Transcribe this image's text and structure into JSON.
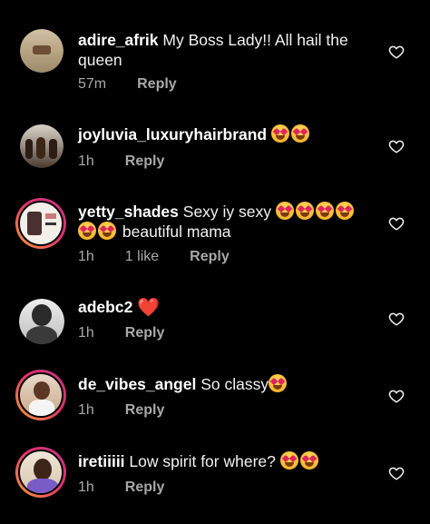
{
  "comments": [
    {
      "username": "adire_afrik",
      "text": "My Boss Lady!! All hail the queen",
      "time": "57m",
      "likes": "",
      "reply": "Reply",
      "emoji_count": 0
    },
    {
      "username": "joyluvia_luxuryhairbrand",
      "text": "",
      "time": "1h",
      "likes": "",
      "reply": "Reply",
      "emoji_count": 2
    },
    {
      "username": "yetty_shades",
      "text": "Sexy iy sexy",
      "text2": "beautiful mama",
      "time": "1h",
      "likes": "1 like",
      "reply": "Reply",
      "emoji_count": 6
    },
    {
      "username": "adebc2",
      "text": "❤️",
      "time": "1h",
      "likes": "",
      "reply": "Reply",
      "emoji_count": 0
    },
    {
      "username": "de_vibes_angel",
      "text": "So classy",
      "time": "1h",
      "likes": "",
      "reply": "Reply",
      "emoji_count": 1
    },
    {
      "username": "iretiiiii",
      "text": "Low spirit for where?",
      "time": "1h",
      "likes": "",
      "reply": "Reply",
      "emoji_count": 2
    }
  ],
  "icons": {
    "like": "heart-outline-icon",
    "emoji": "heart-eyes-emoji-icon"
  },
  "colors": {
    "background": "#000000",
    "text": "#f2f2f2",
    "meta": "#a8a8a8",
    "heart": "#e0245e"
  }
}
